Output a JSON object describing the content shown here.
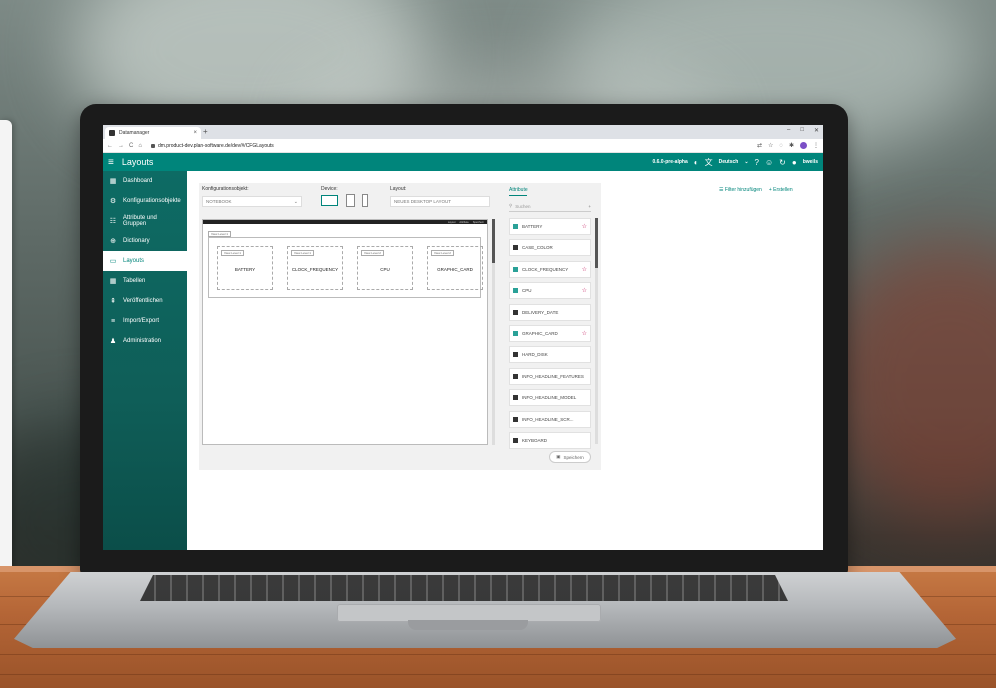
{
  "browser": {
    "tab_title": "Datamanager",
    "tab_close": "×",
    "new_tab": "+",
    "window_controls": [
      "–",
      "□",
      "✕"
    ],
    "nav": [
      "←",
      "→",
      "C",
      "⌂"
    ],
    "url": "dm.product-dev.plan-software.de/dev/#/CFGLayouts"
  },
  "app": {
    "title": "Layouts",
    "version": "0.6.0-pre-alpha",
    "language": "Deutsch",
    "user": "bweils",
    "accent": "#00857b"
  },
  "sidebar": {
    "items": [
      {
        "label": "Dashboard",
        "icon": "dashboard-icon",
        "glyph": "▦"
      },
      {
        "label": "Konfigurationsobjekte",
        "icon": "config-objects-icon",
        "glyph": "⚙"
      },
      {
        "label": "Attribute und Gruppen",
        "icon": "attributes-icon",
        "glyph": "☷"
      },
      {
        "label": "Dictionary",
        "icon": "globe-icon",
        "glyph": "⊕"
      },
      {
        "label": "Layouts",
        "icon": "layout-icon",
        "glyph": "▭",
        "active": true
      },
      {
        "label": "Tabellen",
        "icon": "table-icon",
        "glyph": "▦"
      },
      {
        "label": "Veröffentlichen",
        "icon": "publish-icon",
        "glyph": "⇞"
      },
      {
        "label": "Import/Export",
        "icon": "database-icon",
        "glyph": "≡"
      },
      {
        "label": "Administration",
        "icon": "admin-icon",
        "glyph": "♟"
      }
    ]
  },
  "editor": {
    "config_label": "Konfigurationsobjekt:",
    "config_value": "NOTEBOOK",
    "device_label": "Device:",
    "layout_label": "Layout:",
    "layout_value": "NEUES DESKTOP LAYOUT",
    "mini_header": [
      "Layout",
      "Attribute",
      "Speichern"
    ],
    "view_level_outer": "View Level 1",
    "cards": [
      {
        "level": "View Level 1",
        "name": "BATTERY"
      },
      {
        "level": "View Level 1",
        "name": "CLOCK_FREQUENCY"
      },
      {
        "level": "View Level 2",
        "name": "CPU"
      },
      {
        "level": "View Level 2",
        "name": "GRAPHIC_CARD"
      }
    ]
  },
  "attributes": {
    "title": "Attribute",
    "search_placeholder": "Suchen",
    "items": [
      {
        "name": "BATTERY",
        "color": "#2aa198",
        "fav": true
      },
      {
        "name": "CASE_COLOR",
        "color": "#333333",
        "fav": false
      },
      {
        "name": "CLOCK_FREQUENCY",
        "color": "#2aa198",
        "fav": true
      },
      {
        "name": "CPU",
        "color": "#2aa198",
        "fav": true
      },
      {
        "name": "DELIVERY_DATE",
        "color": "#333333",
        "fav": false
      },
      {
        "name": "GRAPHIC_CARD",
        "color": "#2aa198",
        "fav": true
      },
      {
        "name": "HARD_DISK",
        "color": "#333333",
        "fav": false
      },
      {
        "name": "INFO_HEADLINE_FEATURES",
        "color": "#333333",
        "fav": false
      },
      {
        "name": "INFO_HEADLINE_MODEL",
        "color": "#333333",
        "fav": false
      },
      {
        "name": "INFO_HEADLINE_SCR...",
        "color": "#333333",
        "fav": false
      },
      {
        "name": "KEYBOARD",
        "color": "#333333",
        "fav": false
      }
    ],
    "save_label": "Speichern"
  },
  "actions": {
    "filter": "Filter hinzufügen",
    "create": "Erstellen"
  }
}
